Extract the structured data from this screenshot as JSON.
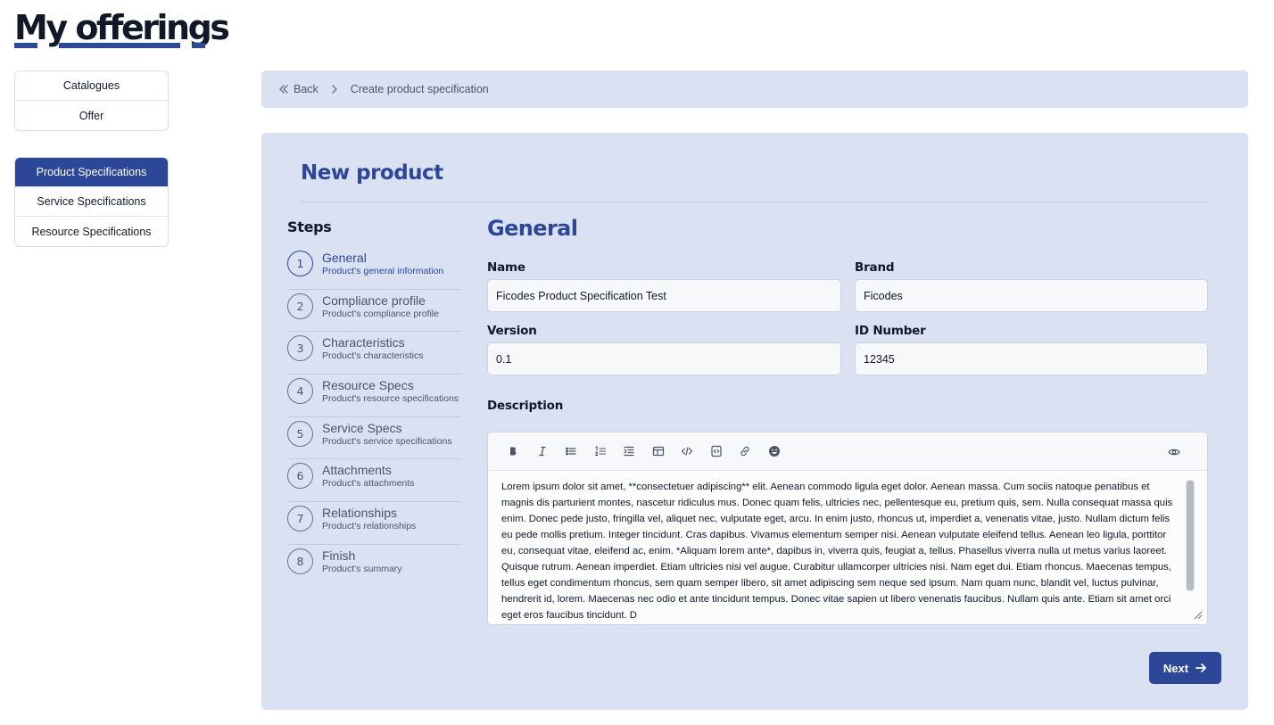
{
  "page": {
    "title": "My offerings"
  },
  "nav": {
    "group1": [
      {
        "label": "Catalogues"
      },
      {
        "label": "Offer"
      }
    ],
    "group2": [
      {
        "label": "Product Specifications",
        "active": true
      },
      {
        "label": "Service Specifications"
      },
      {
        "label": "Resource Specifications"
      }
    ]
  },
  "breadcrumb": {
    "back": "Back",
    "current": "Create product specification"
  },
  "panel": {
    "title": "New product"
  },
  "steps": {
    "heading": "Steps",
    "items": [
      {
        "num": "1",
        "name": "General",
        "sub": "Product's general information",
        "active": true
      },
      {
        "num": "2",
        "name": "Compliance profile",
        "sub": "Product's compliance profile"
      },
      {
        "num": "3",
        "name": "Characteristics",
        "sub": "Product's characteristics"
      },
      {
        "num": "4",
        "name": "Resource Specs",
        "sub": "Product's resource specifications"
      },
      {
        "num": "5",
        "name": "Service Specs",
        "sub": "Product's service specifications"
      },
      {
        "num": "6",
        "name": "Attachments",
        "sub": "Product's attachments"
      },
      {
        "num": "7",
        "name": "Relationships",
        "sub": "Product's relationships"
      },
      {
        "num": "8",
        "name": "Finish",
        "sub": "Product's summary"
      }
    ]
  },
  "form": {
    "title": "General",
    "name_label": "Name",
    "name_value": "Ficodes Product Specification Test",
    "brand_label": "Brand",
    "brand_value": "Ficodes",
    "version_label": "Version",
    "version_value": "0.1",
    "id_label": "ID Number",
    "id_value": "12345",
    "description_label": "Description",
    "description_text": "Lorem ipsum dolor sit amet, **consectetuer adipiscing** elit. Aenean commodo ligula eget dolor. Aenean massa. Cum sociis natoque penatibus et magnis dis parturient montes, nascetur ridiculus mus. Donec quam felis, ultricies nec, pellentesque eu, pretium quis, sem. Nulla consequat massa quis enim. Donec pede justo, fringilla vel, aliquet nec, vulputate eget, arcu. In enim justo, rhoncus ut, imperdiet a, venenatis vitae, justo. Nullam dictum felis eu pede mollis pretium. Integer tincidunt. Cras dapibus. Vivamus elementum semper nisi. Aenean vulputate eleifend tellus. Aenean leo ligula, porttitor eu, consequat vitae, eleifend ac, enim. *Aliquam lorem ante*, dapibus in, viverra quis, feugiat a, tellus. Phasellus viverra nulla ut metus varius laoreet. Quisque rutrum. Aenean imperdiet. Etiam ultricies nisi vel augue. Curabitur ullamcorper ultricies nisi. Nam eget dui. Etiam rhoncus. Maecenas tempus, tellus eget condimentum rhoncus, sem quam semper libero, sit amet adipiscing sem neque sed ipsum. Nam quam nunc, blandit vel, luctus pulvinar, hendrerit id, lorem. Maecenas nec odio et ante tincidunt tempus. Donec vitae sapien ut libero venenatis faucibus. Nullam quis ante. Etiam sit amet orci eget eros faucibus tincidunt. D"
  },
  "toolbar": {
    "icons": [
      "bold-icon",
      "italic-icon",
      "bullet-list-icon",
      "numbered-list-icon",
      "indent-icon",
      "table-icon",
      "code-icon",
      "code-block-icon",
      "link-icon",
      "emoji-icon"
    ],
    "preview_icon": "eye-icon"
  },
  "actions": {
    "next": "Next"
  },
  "colors": {
    "primary": "#2c4798",
    "panel_bg": "#dae1f3"
  }
}
